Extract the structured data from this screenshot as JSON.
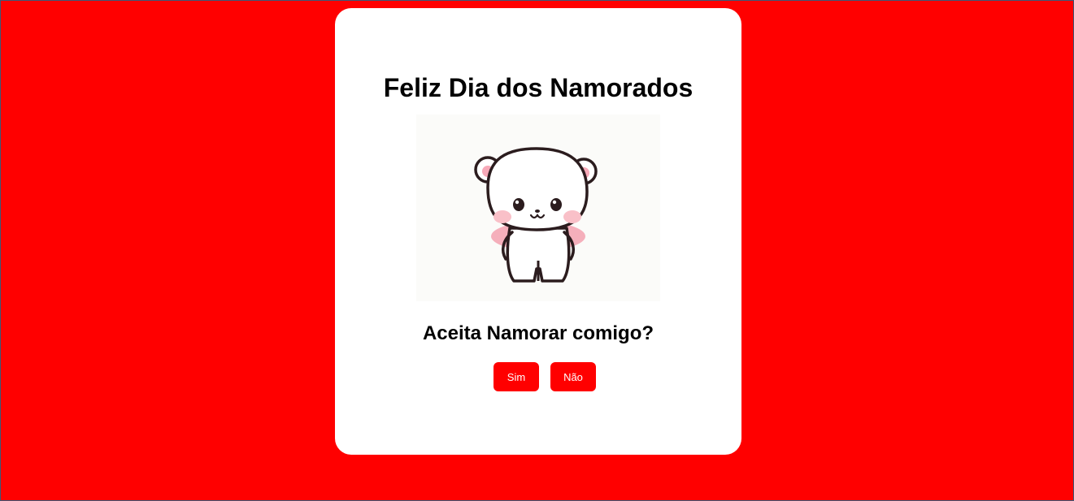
{
  "page": {
    "background_color": "#ff0000",
    "card_color": "#ffffff"
  },
  "card": {
    "title": "Feliz Dia dos Namorados",
    "image": {
      "icon": "cute-bear-illustration"
    },
    "question": "Aceita Namorar comigo?",
    "buttons": {
      "yes_label": "Sim",
      "no_label": "Não",
      "color": "#ff0000",
      "text_color": "#ffffff"
    }
  }
}
